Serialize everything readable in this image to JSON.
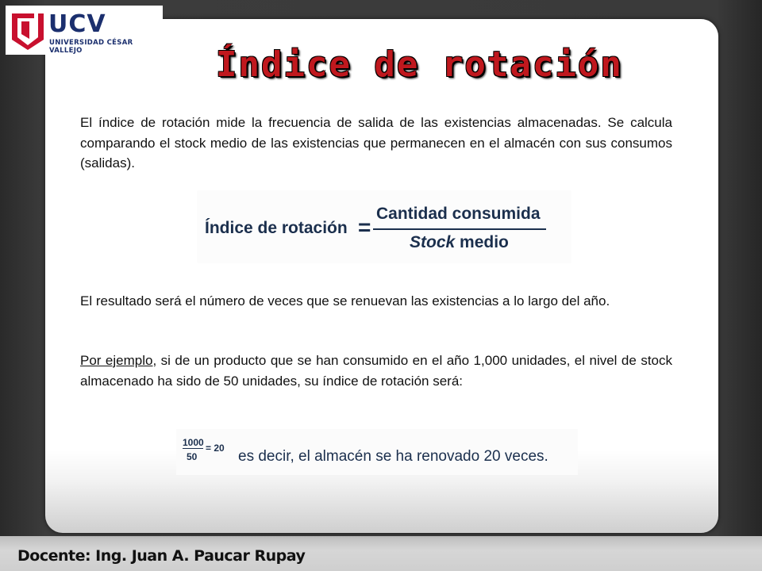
{
  "colors": {
    "title_red": "#c0181e",
    "logo_red": "#c8102e",
    "logo_blue": "#1b2f6e",
    "formula_navy": "#1b2f4d"
  },
  "logo": {
    "icon": "ucv-shield-icon",
    "title": "UCV",
    "subtitle": "UNIVERSIDAD CÉSAR VALLEJO"
  },
  "slide": {
    "title": "Índice de rotación",
    "paragraph_1": "El índice de rotación mide la frecuencia de salida de las existencias almacenadas. Se calcula comparando el stock medio de las existencias que permanecen en el almacén con sus consumos (salidas).",
    "formula": {
      "label": "Índice de rotación",
      "equals": "=",
      "numerator": "Cantidad  consumida",
      "denominator_italic": "Stock",
      "denominator_rest": " medio"
    },
    "paragraph_2": "El resultado será el número de veces que se renuevan las existencias a lo largo del año.",
    "paragraph_3_underlined": "Por ejemplo",
    "paragraph_3_rest": ", si de un producto que se han consumido en el año 1,000 unidades, el nivel de stock almacenado ha sido de 50 unidades, su índice de rotación será:",
    "example": {
      "numerator": "1000",
      "denominator": "50",
      "result": "= 20",
      "text": "es decir, el almacén se ha renovado 20 veces."
    }
  },
  "footer": {
    "text": "Docente: Ing. Juan A. Paucar Rupay"
  }
}
